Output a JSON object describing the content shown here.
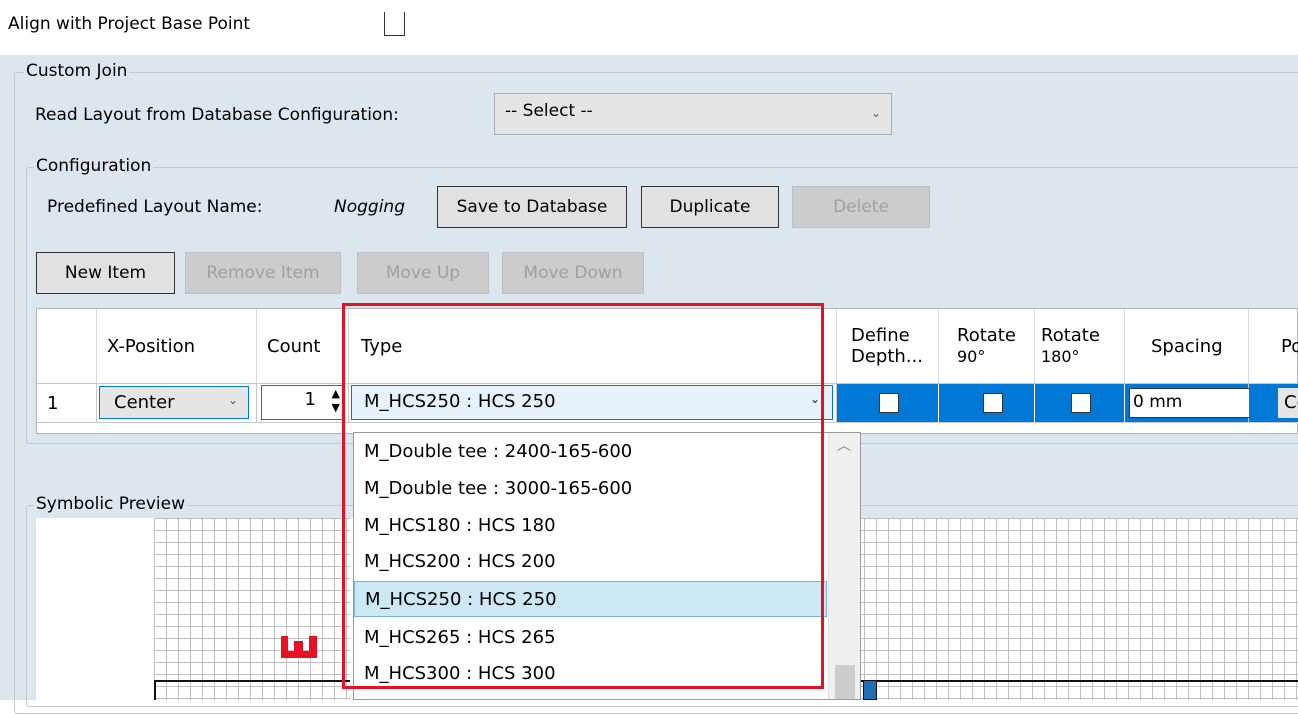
{
  "top": {
    "align_label": "Align with Project Base Point"
  },
  "custom_join": {
    "title": "Custom Join",
    "read_layout_label": "Read Layout from Database Configuration:",
    "select_value": "-- Select --"
  },
  "configuration": {
    "title": "Configuration",
    "predefined_label": "Predefined Layout Name:",
    "predefined_value": "Nogging",
    "save_label": "Save to Database",
    "duplicate_label": "Duplicate",
    "delete_label": "Delete"
  },
  "item_toolbar": {
    "new_label": "New Item",
    "remove_label": "Remove Item",
    "move_up_label": "Move Up",
    "move_down_label": "Move Down"
  },
  "grid": {
    "headers": {
      "x_position": "X-Position",
      "count": "Count",
      "type": "Type",
      "define_depth_1": "Define",
      "define_depth_2": "Depth...",
      "rotate90_1": "Rotate",
      "rotate90_2": "90°",
      "rotate180_1": "Rotate",
      "rotate180_2": "180°",
      "spacing": "Spacing",
      "pos_partial": "Po"
    },
    "row": {
      "index": "1",
      "x_position": "Center",
      "count": "1",
      "type": "M_HCS250 : HCS 250",
      "spacing": "0 mm",
      "pos_partial": "Ce"
    }
  },
  "type_dropdown": {
    "options": [
      "M_Double tee : 2400-165-600",
      "M_Double tee : 3000-165-600",
      "M_HCS180 : HCS 180",
      "M_HCS200 : HCS 200",
      "M_HCS250 : HCS 250",
      "M_HCS265 : HCS 265",
      "M_HCS300 : HCS 300"
    ],
    "selected_index": 4
  },
  "preview": {
    "title": "Symbolic Preview"
  },
  "colors": {
    "panel_bg": "#dce6ee",
    "highlight_red": "#e81123",
    "selection_blue": "#0078d7",
    "dropdown_selected": "#cce8f4"
  }
}
